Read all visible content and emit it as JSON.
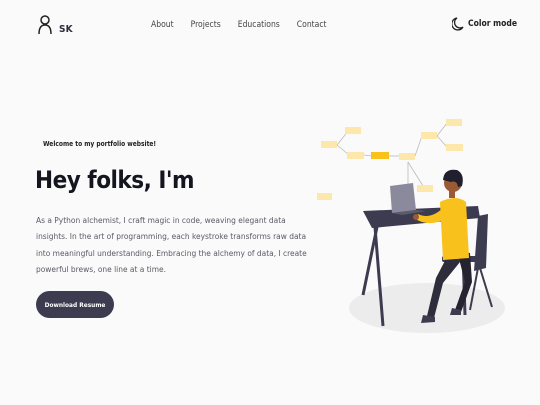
{
  "nav": {
    "logo_text": "SK",
    "links": [
      "About",
      "Projects",
      "Educations",
      "Contact"
    ],
    "color_mode_label": "Color mode"
  },
  "hero": {
    "welcome": "Welcome to my portfolio website!",
    "title": "Hey folks, I'm",
    "description": "As a Python alchemist, I craft magic in code, weaving elegant data insights. In the art of programming, each keystroke transforms raw data into meaningful understanding. Embracing the alchemy of data, I create powerful brews, one line at a time.",
    "button_label": "Download Resume"
  },
  "colors": {
    "accent": "#f9c11c",
    "button_bg": "#3d3b4f",
    "sticky_note": "#fde7aa"
  }
}
